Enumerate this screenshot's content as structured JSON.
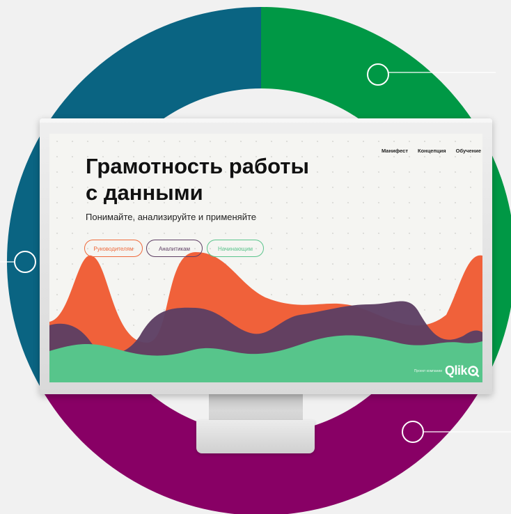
{
  "colors": {
    "ring_teal": "#0a6482",
    "ring_green": "#009845",
    "ring_magenta": "#880065",
    "wave_orange": "#f0613a",
    "wave_purple": "#5d3e63",
    "wave_green": "#57c58b",
    "background": "#f1f1f1"
  },
  "site": {
    "nav": [
      "Манифест",
      "Концепция",
      "Обучение"
    ],
    "title_line1": "Грамотность работы",
    "title_line2": "с данными",
    "subtitle": "Понимайте, анализируйте и применяйте",
    "buttons": {
      "leaders": "Руководителям",
      "analysts": "Аналитикам",
      "beginners": "Начинающим"
    },
    "footer_note": "Проект компании",
    "logo": {
      "name": "Qlik",
      "icon": "qlik-q-icon"
    }
  },
  "icons": [
    "callout-circle-icon",
    "qlik-q-icon"
  ]
}
